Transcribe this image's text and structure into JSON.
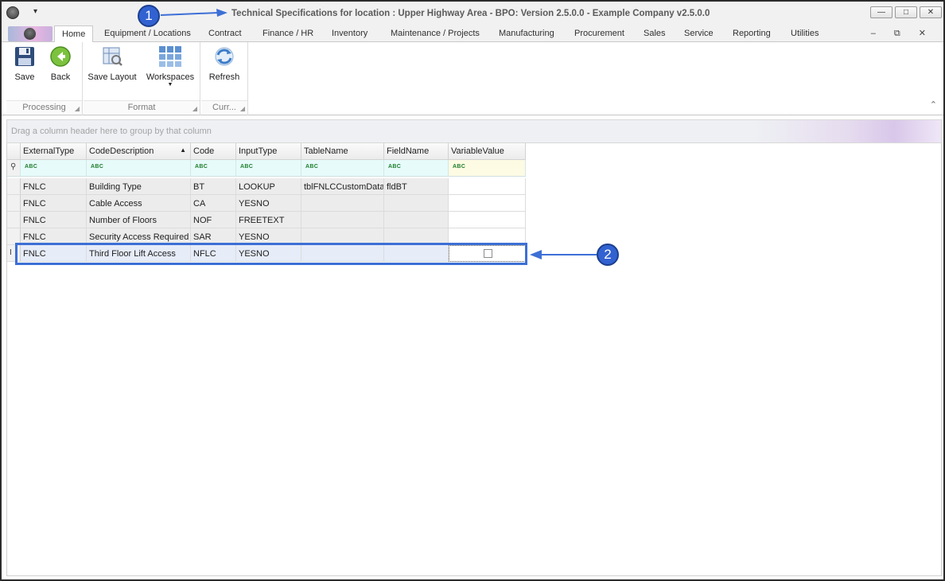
{
  "window": {
    "title": "Technical Specifications for location : Upper Highway Area - BPO: Version 2.5.0.0 - Example Company v2.5.0.0",
    "controls": {
      "minimize": "—",
      "maximize": "□",
      "close": "✕"
    },
    "qat_glyph": "▾",
    "mdi_glyphs": "– ⧉ ✕"
  },
  "tabs": [
    {
      "label": "Home"
    },
    {
      "label": "Equipment / Locations"
    },
    {
      "label": "Contract"
    },
    {
      "label": "Finance / HR"
    },
    {
      "label": "Inventory"
    },
    {
      "label": "Maintenance / Projects"
    },
    {
      "label": "Manufacturing"
    },
    {
      "label": "Procurement"
    },
    {
      "label": "Sales"
    },
    {
      "label": "Service"
    },
    {
      "label": "Reporting"
    },
    {
      "label": "Utilities"
    }
  ],
  "ribbon": {
    "groups": [
      {
        "label": "Processing",
        "buttons": [
          {
            "label": "Save",
            "icon": "save-icon"
          },
          {
            "label": "Back",
            "icon": "back-icon"
          }
        ]
      },
      {
        "label": "Format",
        "buttons": [
          {
            "label": "Save Layout",
            "icon": "save-layout-icon"
          },
          {
            "label": "Workspaces",
            "icon": "workspaces-icon"
          }
        ]
      },
      {
        "label": "Curr...",
        "buttons": [
          {
            "label": "Refresh",
            "icon": "refresh-icon"
          }
        ]
      }
    ],
    "collapse_glyph": "⌃"
  },
  "grid": {
    "group_panel_hint": "Drag a column header here to group by that column",
    "columns": [
      "ExternalType",
      "CodeDescription",
      "Code",
      "InputType",
      "TableName",
      "FieldName",
      "VariableValue"
    ],
    "sort_glyph": "▲",
    "filter_glyph": "ABC",
    "filter_row_glyph": "⚲",
    "rows": [
      [
        "FNLC",
        "Building Type",
        "BT",
        "LOOKUP",
        "tblFNLCCustomData",
        "fldBT",
        ""
      ],
      [
        "FNLC",
        "Cable Access",
        "CA",
        "YESNO",
        "",
        "",
        ""
      ],
      [
        "FNLC",
        "Number of Floors",
        "NOF",
        "FREETEXT",
        "",
        "",
        ""
      ],
      [
        "FNLC",
        "Security Access Required",
        "SAR",
        "YESNO",
        "",
        "",
        ""
      ],
      [
        "FNLC",
        "Third Floor Lift Access",
        "NFLC",
        "YESNO",
        "",
        "",
        ""
      ]
    ],
    "selected_row_indicator": "I"
  },
  "annotations": {
    "callout_1": "1",
    "callout_2": "2"
  },
  "colors": {
    "accent": "#3d6fd6",
    "callout": "#3262d1",
    "filter_row": "#e7fbfb"
  }
}
